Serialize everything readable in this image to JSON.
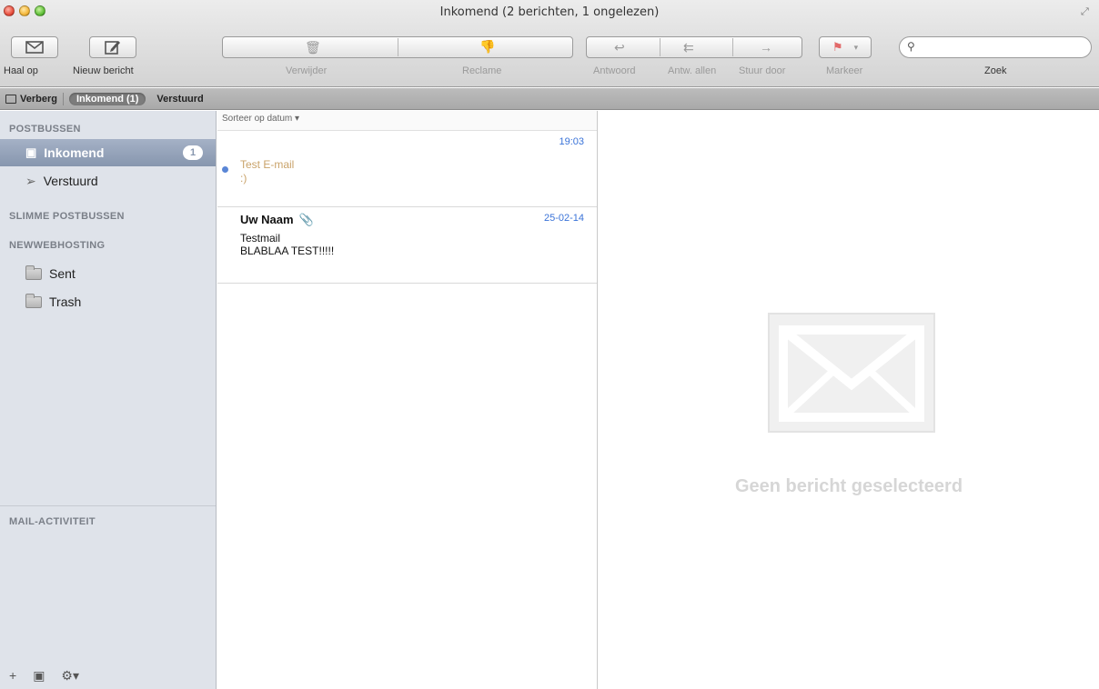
{
  "window": {
    "title": "Inkomend (2 berichten, 1 ongelezen)"
  },
  "toolbar": {
    "get_mail": "Haal op",
    "new_message": "Nieuw bericht",
    "delete": "Verwijder",
    "junk": "Reclame",
    "reply": "Antwoord",
    "reply_all": "Antw. allen",
    "forward": "Stuur door",
    "flag": "Markeer",
    "search_label": "Zoek",
    "search_placeholder": ""
  },
  "favbar": {
    "hide": "Verberg",
    "inbox": "Inkomend (1)",
    "sent": "Verstuurd"
  },
  "sidebar": {
    "mailboxes_header": "POSTBUSSEN",
    "inbox": {
      "label": "Inkomend",
      "count": "1"
    },
    "sent": {
      "label": "Verstuurd"
    },
    "smart_header": "SLIMME POSTBUSSEN",
    "account_header": "NEWWEBHOSTING",
    "folders": [
      {
        "label": "Sent"
      },
      {
        "label": "Trash"
      }
    ],
    "activity_header": "MAIL-ACTIVITEIT"
  },
  "message_list": {
    "sort_label": "Sorteer op datum ▾",
    "messages": [
      {
        "from": "",
        "time": "19:03",
        "subject": "Test E-mail",
        "preview": ":)",
        "unread": true
      },
      {
        "from": "Uw Naam",
        "time": "25-02-14",
        "subject": "Testmail",
        "preview": "BLABLAA TEST!!!!!",
        "unread": false,
        "attachment": true
      }
    ]
  },
  "reader": {
    "empty_text": "Geen bericht geselecteerd"
  },
  "colors": {
    "accent_blue": "#3a73d8",
    "selection": "#8796ae",
    "unread_subject": "#c9a36a"
  }
}
